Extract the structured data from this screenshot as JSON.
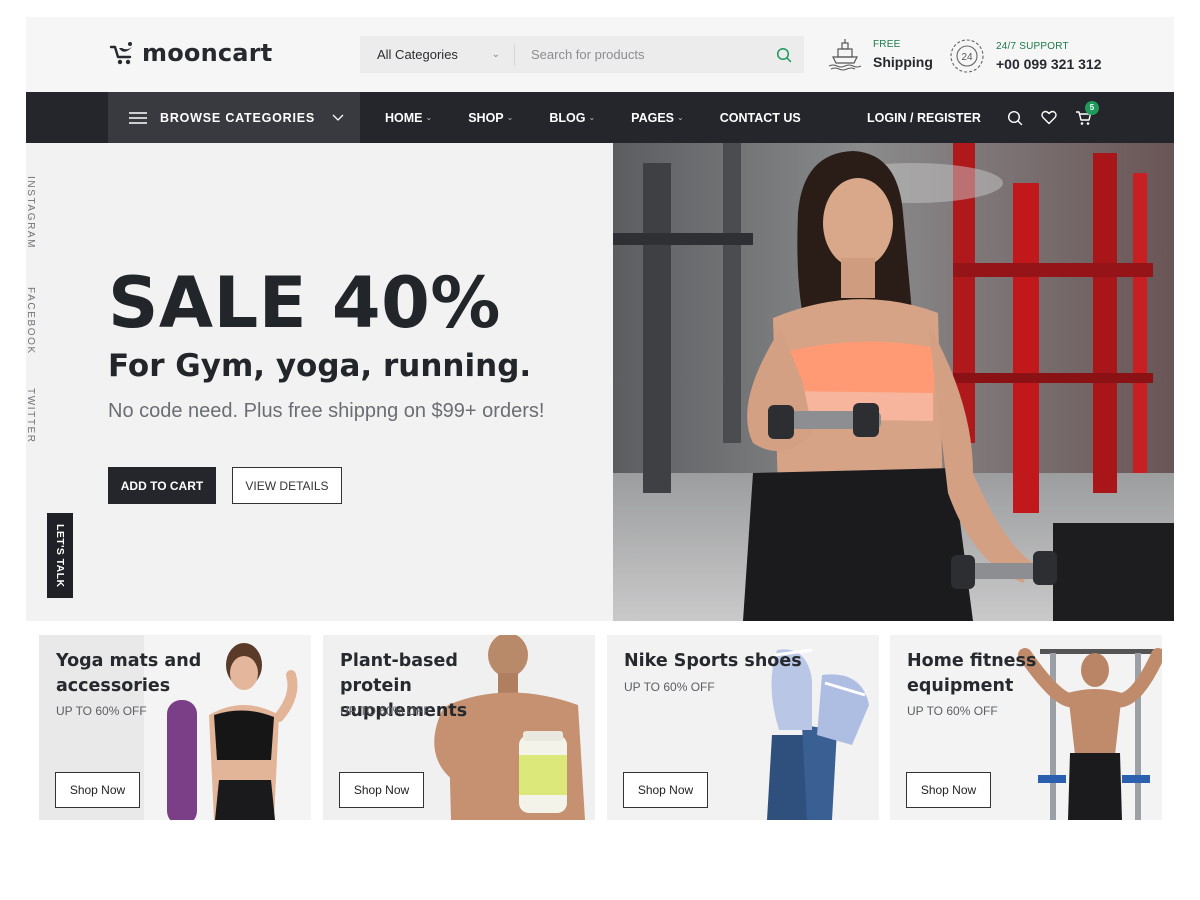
{
  "brand": {
    "name": "mooncart"
  },
  "search": {
    "category": "All Categories",
    "placeholder": "Search for products"
  },
  "header_info": {
    "shipping": {
      "small": "FREE",
      "big": "Shipping"
    },
    "support": {
      "small": "24/7 SUPPORT",
      "big": "+00 099 321 312"
    }
  },
  "nav": {
    "browse_label": "BROWSE CATEGORIES",
    "items": [
      {
        "label": "HOME",
        "dropdown": true
      },
      {
        "label": "SHOP",
        "dropdown": true
      },
      {
        "label": "BLOG",
        "dropdown": true
      },
      {
        "label": "PAGES",
        "dropdown": true
      },
      {
        "label": "CONTACT US",
        "dropdown": false
      }
    ],
    "login_label": "LOGIN / REGISTER",
    "cart_count": "5"
  },
  "socials": [
    "INSTAGRAM",
    "FACEBOOK",
    "TWITTER"
  ],
  "lets_talk": "LET'S TALK",
  "hero": {
    "title": "SALE 40%",
    "subtitle": "For Gym, yoga, running.",
    "description": "No code need. Plus free shippng on $99+ orders!",
    "primary_button": "ADD TO CART",
    "secondary_button": "VIEW DETAILS"
  },
  "cards": [
    {
      "title": "Yoga mats and accessories",
      "offer": "UP TO 60% OFF",
      "button": "Shop Now"
    },
    {
      "title": "Plant-based protein supplements",
      "offer": "UP TO 60% OFF",
      "button": "Shop Now"
    },
    {
      "title": "Nike Sports shoes",
      "offer": "UP TO 60% OFF",
      "button": "Shop Now"
    },
    {
      "title": "Home fitness equipment",
      "offer": "UP TO 60% OFF",
      "button": "Shop Now"
    }
  ],
  "colors": {
    "dark": "#24262c",
    "accent_green": "#1f9a5b",
    "hero_bg": "#f2f2f3"
  }
}
